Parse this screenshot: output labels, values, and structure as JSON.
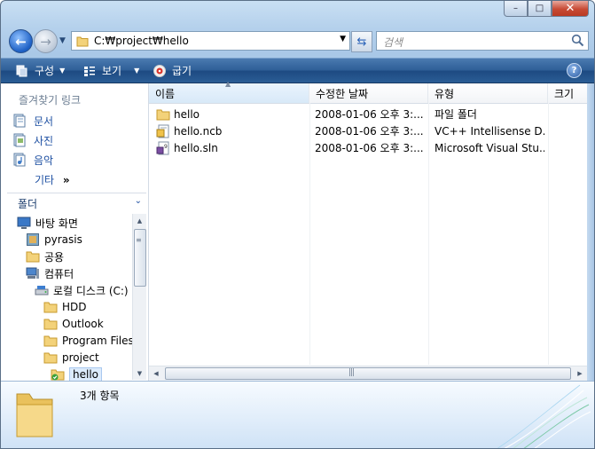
{
  "window": {
    "minimize": "–",
    "maximize": "□",
    "close": "✕"
  },
  "address": {
    "path": "C:₩project₩hello",
    "back_icon": "arrow-left-icon",
    "forward_icon": "arrow-right-icon"
  },
  "search": {
    "placeholder": "검색"
  },
  "toolbar": {
    "organize": "구성",
    "views": "보기",
    "burn": "굽기",
    "help": "?"
  },
  "nav": {
    "favorites_title": "즐겨찾기 링크",
    "favorites": [
      {
        "label": "문서",
        "icon": "documents-icon"
      },
      {
        "label": "사진",
        "icon": "pictures-icon"
      },
      {
        "label": "음악",
        "icon": "music-icon"
      }
    ],
    "more": "기타",
    "more_arrow": "»",
    "folders_title": "폴더",
    "tree": [
      {
        "label": "바탕 화면",
        "icon": "desktop-icon",
        "selected": false
      },
      {
        "label": "pyrasis",
        "icon": "user-folder-icon",
        "selected": false
      },
      {
        "label": "공용",
        "icon": "folder-icon",
        "selected": false
      },
      {
        "label": "컴퓨터",
        "icon": "computer-icon",
        "selected": false
      },
      {
        "label": "로컬 디스크 (C:)",
        "icon": "drive-icon",
        "selected": false
      },
      {
        "label": "HDD",
        "icon": "folder-icon",
        "selected": false
      },
      {
        "label": "Outlook",
        "icon": "folder-icon",
        "selected": false
      },
      {
        "label": "Program Files",
        "icon": "folder-icon",
        "selected": false
      },
      {
        "label": "project",
        "icon": "folder-icon",
        "selected": false
      },
      {
        "label": "hello",
        "icon": "folder-check-icon",
        "selected": true
      }
    ]
  },
  "files": {
    "columns": [
      "이름",
      "수정한 날짜",
      "유형",
      "크기"
    ],
    "rows": [
      {
        "name": "hello",
        "date": "2008-01-06 오후 3:...",
        "type": "파일 폴더",
        "size": "",
        "icon": "folder-icon"
      },
      {
        "name": "hello.ncb",
        "date": "2008-01-06 오후 3:...",
        "type": "VC++ Intellisense D...",
        "size": "",
        "icon": "ncb-file-icon"
      },
      {
        "name": "hello.sln",
        "date": "2008-01-06 오후 3:...",
        "type": "Microsoft Visual Stu...",
        "size": "",
        "icon": "sln-file-icon"
      }
    ]
  },
  "details": {
    "count": "3개 항목"
  },
  "colors": {
    "toolbar": "#2f5f97",
    "link": "#1e50a2",
    "selection": "#dcebfc"
  }
}
